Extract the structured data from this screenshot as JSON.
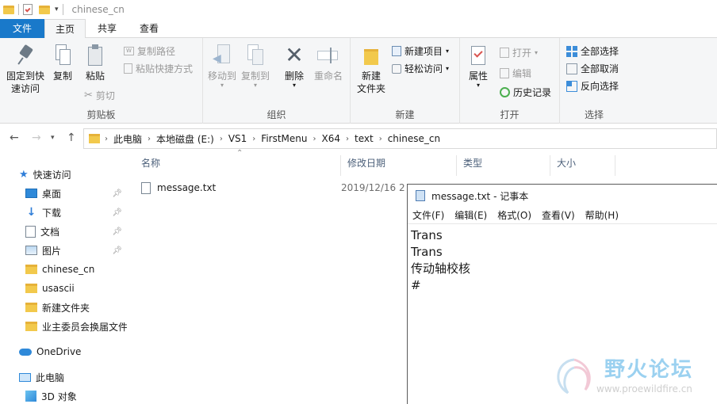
{
  "window": {
    "title": "chinese_cn"
  },
  "ribbon_tabs": [
    {
      "label": "文件"
    },
    {
      "label": "主页"
    },
    {
      "label": "共享"
    },
    {
      "label": "查看"
    }
  ],
  "ribbon": {
    "clipboard": {
      "pin_label": "固定到快\n速访问",
      "copy_label": "复制",
      "paste_label": "粘贴",
      "copy_path": "复制路径",
      "paste_shortcut": "粘贴快捷方式",
      "cut": "剪切",
      "group_label": "剪贴板"
    },
    "organize": {
      "move_to": "移动到",
      "copy_to": "复制到",
      "delete": "删除",
      "rename": "重命名",
      "group_label": "组织"
    },
    "new": {
      "new_folder": "新建\n文件夹",
      "new_item": "新建项目",
      "easy_access": "轻松访问",
      "group_label": "新建"
    },
    "open": {
      "properties": "属性",
      "open": "打开",
      "edit": "编辑",
      "history": "历史记录",
      "group_label": "打开"
    },
    "select": {
      "select_all": "全部选择",
      "select_none": "全部取消",
      "invert": "反向选择",
      "group_label": "选择"
    }
  },
  "address": {
    "crumbs": [
      "此电脑",
      "本地磁盘 (E:)",
      "VS1",
      "FirstMenu",
      "X64",
      "text",
      "chinese_cn"
    ]
  },
  "navpane": {
    "quick_access": "快速访问",
    "items": [
      {
        "label": "桌面",
        "icon": "desktop-icon",
        "pinned": true
      },
      {
        "label": "下载",
        "icon": "download-icon",
        "pinned": true
      },
      {
        "label": "文档",
        "icon": "document-icon",
        "pinned": true
      },
      {
        "label": "图片",
        "icon": "picture-icon",
        "pinned": true
      },
      {
        "label": "chinese_cn",
        "icon": "folder-icon",
        "pinned": false
      },
      {
        "label": "usascii",
        "icon": "folder-icon",
        "pinned": false
      },
      {
        "label": "新建文件夹",
        "icon": "folder-icon",
        "pinned": false
      },
      {
        "label": "业主委员会换届文件",
        "icon": "folder-icon",
        "pinned": false
      }
    ],
    "onedrive": "OneDrive",
    "this_pc": "此电脑",
    "objects_3d": "3D 对象"
  },
  "filelist": {
    "columns": [
      "名称",
      "修改日期",
      "类型",
      "大小"
    ],
    "rows": [
      {
        "name": "message.txt",
        "modified": "2019/12/16 2"
      }
    ]
  },
  "notepad": {
    "title": "message.txt - 记事本",
    "menu": [
      "文件(F)",
      "编辑(E)",
      "格式(O)",
      "查看(V)",
      "帮助(H)"
    ],
    "lines": [
      "Trans",
      "Trans",
      "传动轴校核",
      "#"
    ]
  },
  "watermark": {
    "brand": "野火论坛",
    "url": "www.proewildfire.cn"
  },
  "colors": {
    "file_tab": "#1979ca",
    "ribbon_bg": "#f5f6f7",
    "folder": "#f2c94c",
    "watermark": "#9bd1f0"
  }
}
